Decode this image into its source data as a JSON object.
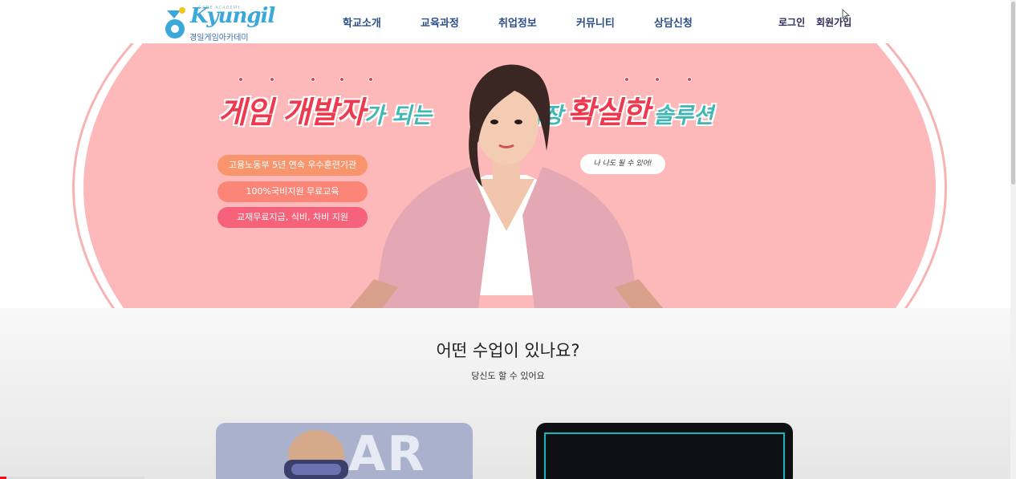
{
  "header": {
    "logo": {
      "word": "Kyungil",
      "tagline": "GAME ACADEMY",
      "subtitle": "경일게임아카데미"
    },
    "nav": [
      {
        "label": "학교소개"
      },
      {
        "label": "교육과정"
      },
      {
        "label": "취업정보"
      },
      {
        "label": "커뮤니티"
      },
      {
        "label": "상담신청"
      }
    ],
    "login": "로그인",
    "signup": "회원가입"
  },
  "hero": {
    "headline_part1": "게임 개발자",
    "headline_part2": "가 되는",
    "headline_part3": "가장",
    "headline_part4": "확실한",
    "headline_part5": "솔루션",
    "pills": [
      "고용노동부 5년 연속 우수훈련기관",
      "100%국비지원 무료교육",
      "교재무료지급, 식비, 차비 지원"
    ],
    "bubble": "나 나도 될 수 있어!",
    "colors": {
      "background": "#fdb9b9",
      "accent_red": "#ee3a4f",
      "accent_teal": "#3fb7b5"
    }
  },
  "section": {
    "title": "어떤 수업이 있나요?",
    "subtitle": "당신도 할 수 있어요",
    "cards": [
      {
        "label": "AR"
      },
      {
        "label": ""
      }
    ]
  },
  "video_progress": 0.045
}
